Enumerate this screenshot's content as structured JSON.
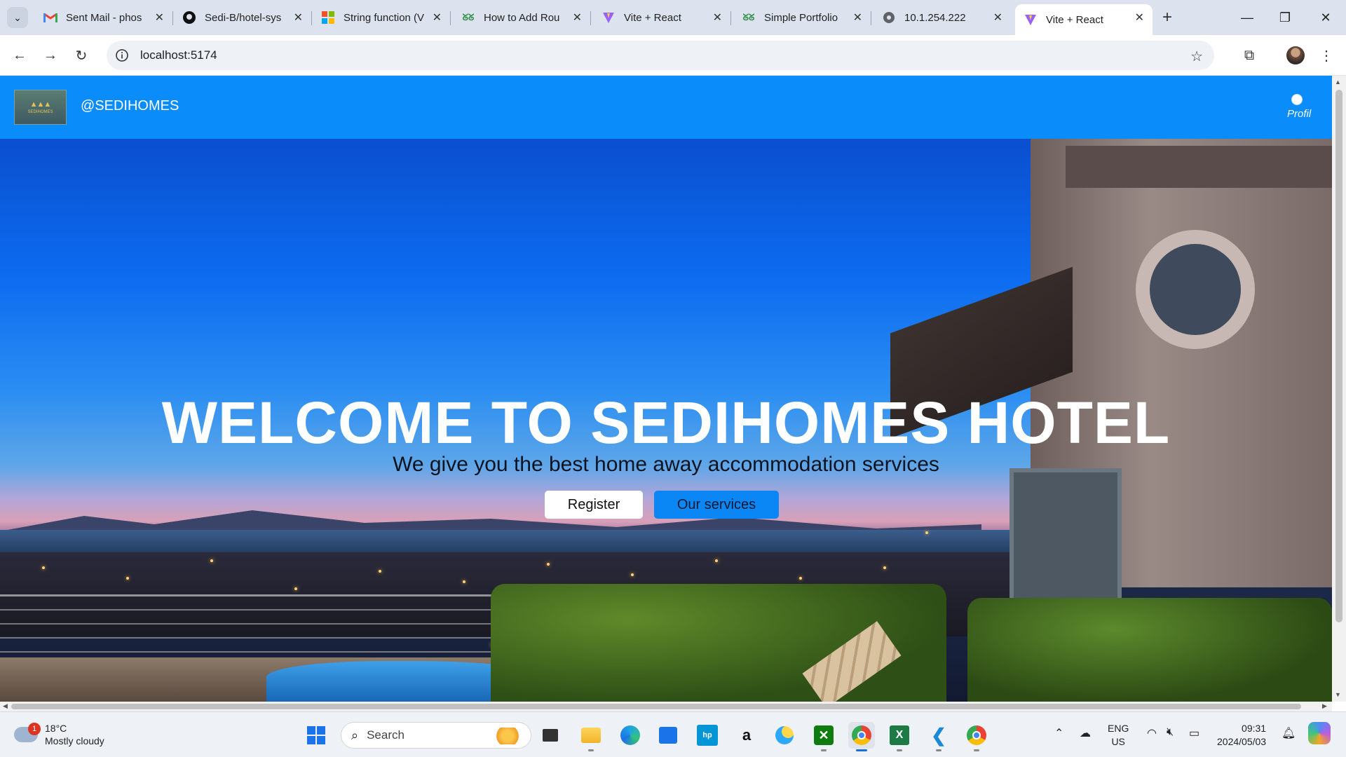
{
  "browser": {
    "tabs": [
      {
        "title": "Sent Mail - phos",
        "icon": "gmail-icon"
      },
      {
        "title": "Sedi-B/hotel-sys",
        "icon": "github-icon"
      },
      {
        "title": "String function (V",
        "icon": "microsoft-icon"
      },
      {
        "title": "How to Add Rou",
        "icon": "geeksforgeeks-icon"
      },
      {
        "title": "Vite + React",
        "icon": "vite-icon"
      },
      {
        "title": "Simple Portfolio",
        "icon": "geeksforgeeks-icon"
      },
      {
        "title": "10.1.254.222",
        "icon": "globe-icon"
      },
      {
        "title": "Vite + React",
        "icon": "vite-icon",
        "active": true
      }
    ],
    "url": "localhost:5174"
  },
  "site": {
    "logo_text": "SEDIHOMES",
    "brand": "@SEDIHOMES",
    "profile_alt": "Profil",
    "hero": {
      "title": "WELCOME TO SEDIHOMES HOTEL",
      "subtitle": "We give you the best home away accommodation services",
      "register_label": "Register",
      "services_label": "Our services"
    },
    "colors": {
      "nav": "#0a8cfb",
      "services_button": "#0a86f5"
    }
  },
  "taskbar": {
    "weather_badge": "1",
    "temperature": "18°C",
    "condition": "Mostly cloudy",
    "search_placeholder": "Search",
    "lang_top": "ENG",
    "lang_bottom": "US",
    "time": "09:31",
    "date": "2024/05/03"
  }
}
